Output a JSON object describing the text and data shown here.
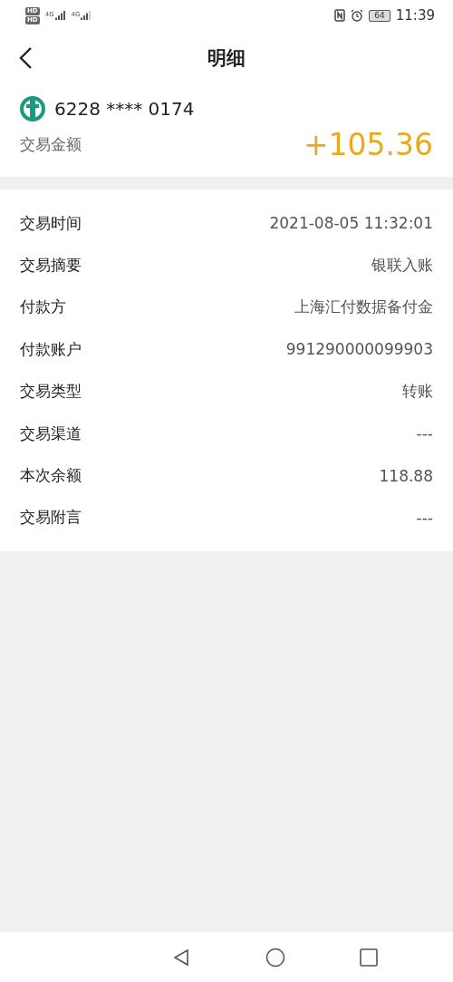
{
  "status_bar": {
    "sims": [
      {
        "hd": "HD",
        "network": "4G"
      },
      {
        "hd": "HD",
        "network": "4G"
      }
    ],
    "battery": "64",
    "time": "11:39"
  },
  "header": {
    "title": "明细"
  },
  "account": {
    "card_number": "6228 **** 0174",
    "amount_label": "交易金额",
    "amount": "+105.36"
  },
  "details": [
    {
      "label": "交易时间",
      "value": "2021-08-05 11:32:01"
    },
    {
      "label": "交易摘要",
      "value": "银联入账"
    },
    {
      "label": "付款方",
      "value": "上海汇付数据备付金"
    },
    {
      "label": "付款账户",
      "value": "991290000099903"
    },
    {
      "label": "交易类型",
      "value": "转账"
    },
    {
      "label": "交易渠道",
      "value": "---"
    },
    {
      "label": "本次余额",
      "value": "118.88"
    },
    {
      "label": "交易附言",
      "value": "---"
    }
  ]
}
